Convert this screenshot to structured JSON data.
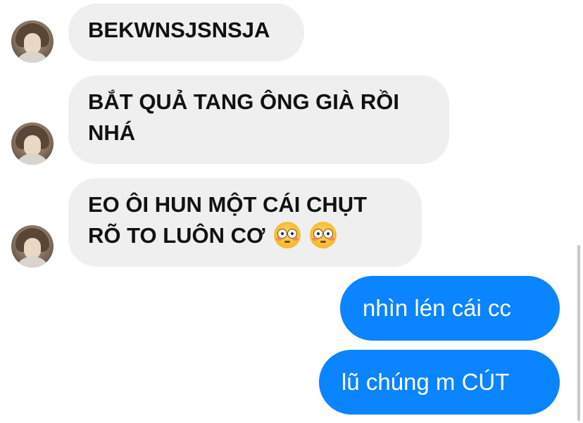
{
  "messages": [
    {
      "side": "incoming",
      "text": "BEKWNSJSNSJA"
    },
    {
      "side": "incoming",
      "text": "BẮT QUẢ TANG ÔNG GIÀ RỒI NHÁ"
    },
    {
      "side": "incoming",
      "line1": "EO ÔI HUN MỘT CÁI CHỤT",
      "line2": "RÕ TO LUÔN CƠ",
      "emoji": "flushed-face-emoji ×2"
    },
    {
      "side": "outgoing",
      "text": "nhìn lén cái cc"
    },
    {
      "side": "outgoing",
      "text": "lũ chúng m CÚT"
    }
  ],
  "colors": {
    "incoming_bubble": "#efefef",
    "outgoing_bubble": "#0a84ff",
    "incoming_text": "#111111",
    "outgoing_text": "#ffffff"
  },
  "icons": {
    "avatar": "contact-avatar",
    "emoji": "flushed-face-emoji"
  }
}
